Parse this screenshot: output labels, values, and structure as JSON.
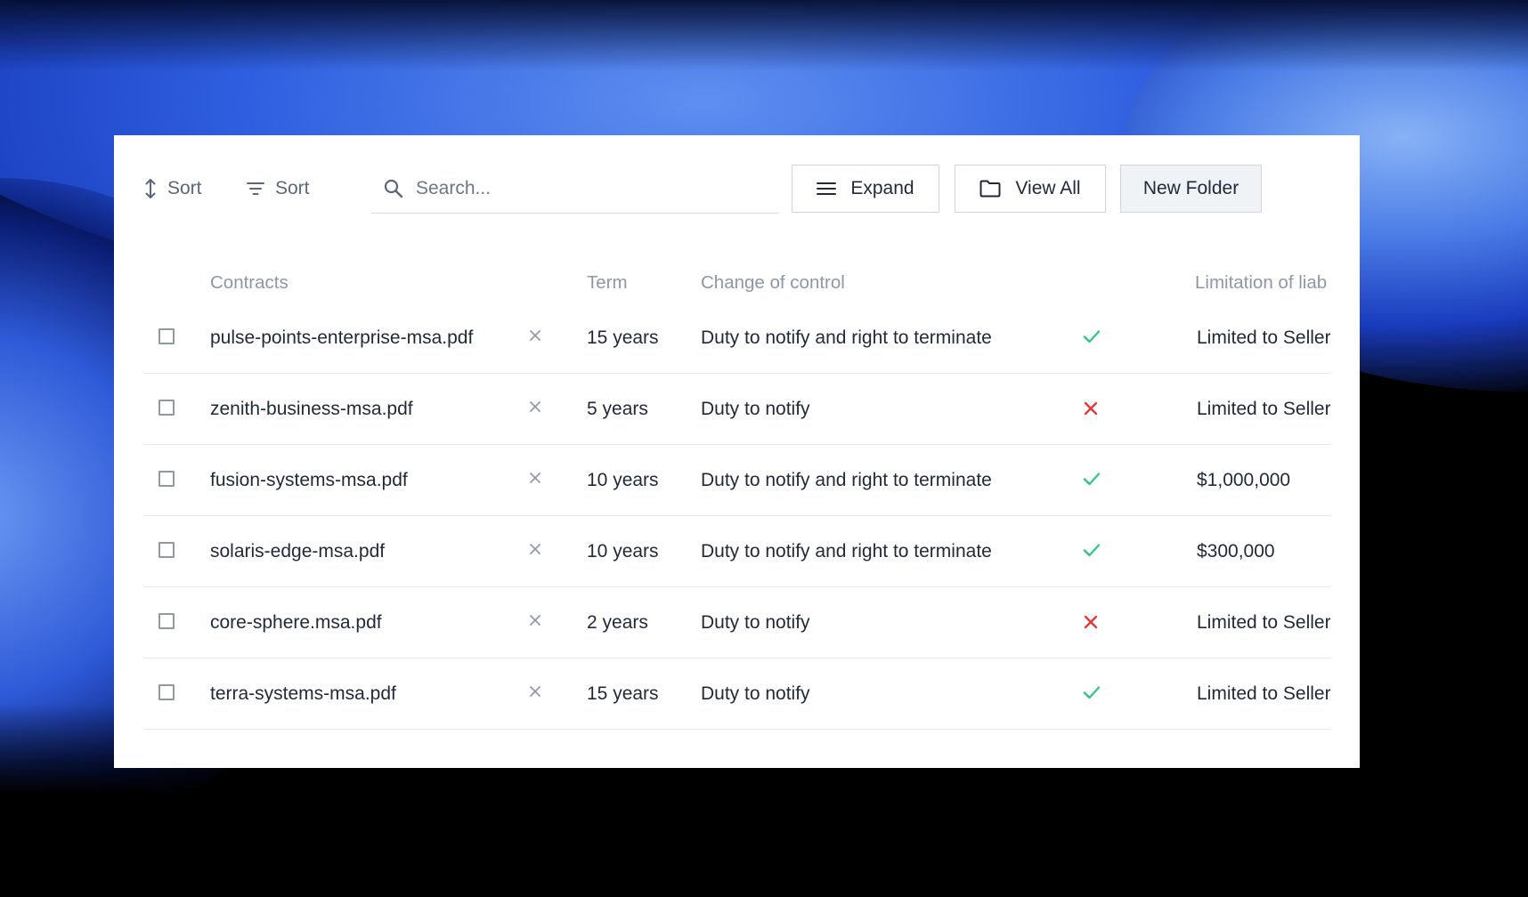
{
  "toolbar": {
    "sort_label": "Sort",
    "filter_sort_label": "Sort",
    "search_placeholder": "Search...",
    "expand_label": "Expand",
    "view_all_label": "View All",
    "new_folder_label": "New Folder"
  },
  "table": {
    "headers": {
      "contracts": "Contracts",
      "term": "Term",
      "change_of_control": "Change of control",
      "limitation": "Limitation of liab"
    },
    "rows": [
      {
        "name": "pulse-points-enterprise-msa.pdf",
        "term": "15 years",
        "change_of_control": "Duty to notify and right to terminate",
        "status": "check",
        "limitation": "Limited to Seller's"
      },
      {
        "name": "zenith-business-msa.pdf",
        "term": "5 years",
        "change_of_control": "Duty to notify",
        "status": "cross",
        "limitation": "Limited to Seller's"
      },
      {
        "name": "fusion-systems-msa.pdf",
        "term": "10 years",
        "change_of_control": "Duty to notify and right to terminate",
        "status": "check",
        "limitation": "$1,000,000"
      },
      {
        "name": "solaris-edge-msa.pdf",
        "term": "10 years",
        "change_of_control": "Duty to notify and right to terminate",
        "status": "check",
        "limitation": "$300,000"
      },
      {
        "name": "core-sphere.msa.pdf",
        "term": "2 years",
        "change_of_control": "Duty to notify",
        "status": "cross",
        "limitation": "Limited to Seller's"
      },
      {
        "name": "terra-systems-msa.pdf",
        "term": "15 years",
        "change_of_control": "Duty to notify",
        "status": "check",
        "limitation": "Limited to Seller's"
      }
    ]
  },
  "colors": {
    "check": "#34c78a",
    "cross": "#e5383b",
    "accent_bg": "#2f5fe0"
  }
}
